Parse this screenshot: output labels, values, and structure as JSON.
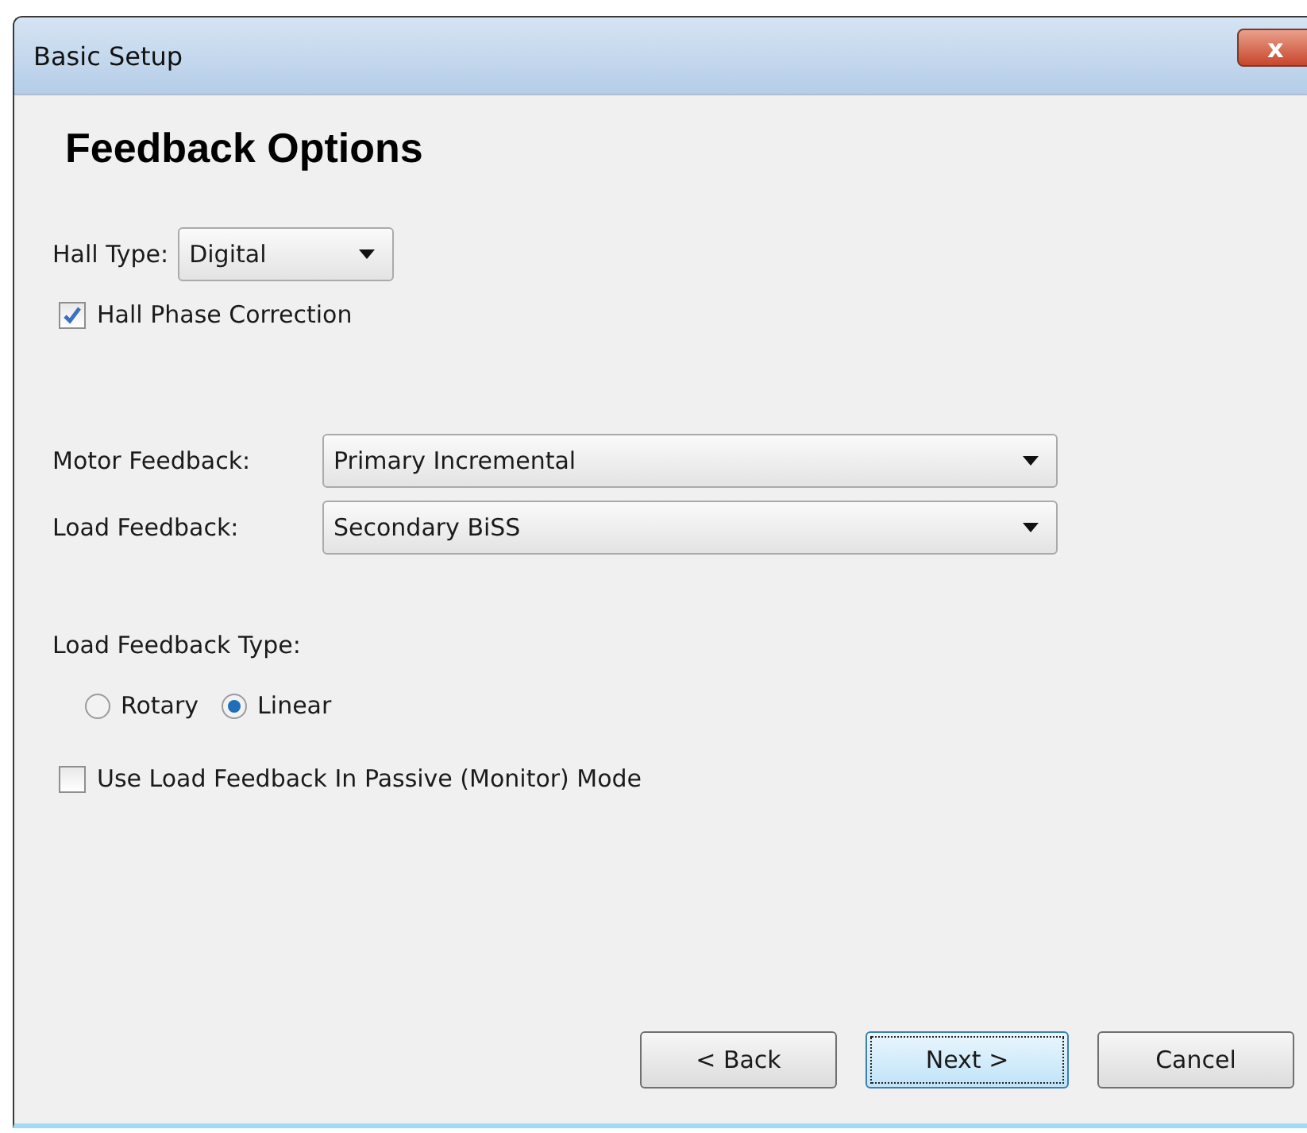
{
  "window": {
    "title": "Basic Setup",
    "close": "x"
  },
  "heading": "Feedback Options",
  "hall_type": {
    "label": "Hall Type:",
    "value": "Digital"
  },
  "hall_phase_correction": {
    "label": "Hall Phase Correction",
    "checked": true
  },
  "feedback_selects": [
    {
      "label": "Motor Feedback:",
      "value": "Primary Incremental"
    },
    {
      "label": "Load Feedback:",
      "value": "Secondary BiSS"
    }
  ],
  "load_feedback_type": {
    "label": "Load Feedback Type:",
    "options": [
      {
        "label": "Rotary",
        "selected": false
      },
      {
        "label": "Linear",
        "selected": true
      }
    ]
  },
  "passive_mode": {
    "label": "Use Load Feedback In Passive (Monitor) Mode",
    "checked": false
  },
  "buttons": [
    {
      "label": "< Back",
      "focused": false
    },
    {
      "label": "Next >",
      "focused": true
    },
    {
      "label": "Cancel",
      "focused": false
    }
  ]
}
